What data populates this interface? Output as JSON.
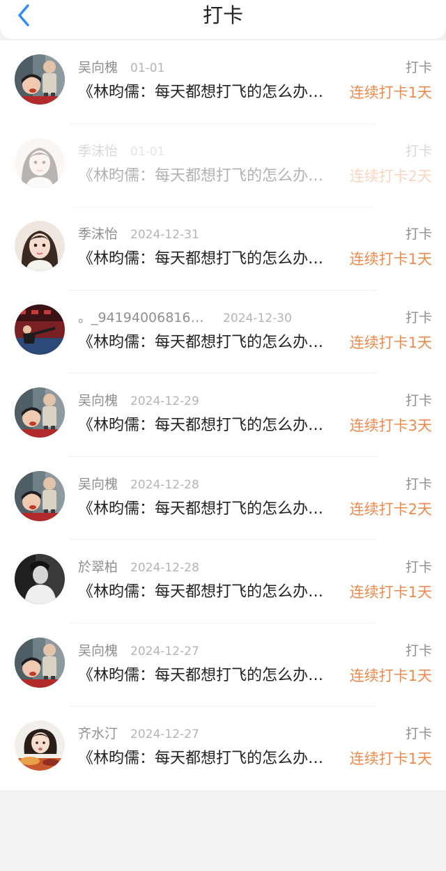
{
  "header": {
    "title": "打卡",
    "back_icon": "chevron-left-icon",
    "back_color": "#2d8cf0"
  },
  "colors": {
    "streak": "#ee8a4c",
    "meta": "#8f8f8f",
    "date": "#b4b4b4"
  },
  "records": [
    {
      "name": "吴向槐",
      "date": "01-01",
      "tag": "打卡",
      "content": "《林昀儒：每天都想打飞的怎么办…",
      "streak": "连续打卡1天",
      "avatar": "avatar-child",
      "faded": false
    },
    {
      "name": "季沫怡",
      "date": "01-01",
      "tag": "打卡",
      "content": "《林昀儒：每天都想打飞的怎么办…",
      "streak": "连续打卡2天",
      "avatar": "avatar-girl",
      "faded": true
    },
    {
      "name": "季沫怡",
      "date": "2024-12-31",
      "tag": "打卡",
      "content": "《林昀儒：每天都想打飞的怎么办…",
      "streak": "连续打卡1天",
      "avatar": "avatar-girl",
      "faded": false
    },
    {
      "name": "。_941940068162…",
      "date": "2024-12-30",
      "tag": "打卡",
      "content": "《林昀儒：每天都想打飞的怎么办…",
      "streak": "连续打卡1天",
      "avatar": "avatar-table-tennis",
      "faded": false
    },
    {
      "name": "吴向槐",
      "date": "2024-12-29",
      "tag": "打卡",
      "content": "《林昀儒：每天都想打飞的怎么办…",
      "streak": "连续打卡3天",
      "avatar": "avatar-child",
      "faded": false
    },
    {
      "name": "吴向槐",
      "date": "2024-12-28",
      "tag": "打卡",
      "content": "《林昀儒：每天都想打飞的怎么办…",
      "streak": "连续打卡2天",
      "avatar": "avatar-child",
      "faded": false
    },
    {
      "name": "於翠柏",
      "date": "2024-12-28",
      "tag": "打卡",
      "content": "《林昀儒：每天都想打飞的怎么办…",
      "streak": "连续打卡1天",
      "avatar": "avatar-bw-man",
      "faded": false
    },
    {
      "name": "吴向槐",
      "date": "2024-12-27",
      "tag": "打卡",
      "content": "《林昀儒：每天都想打飞的怎么办…",
      "streak": "连续打卡1天",
      "avatar": "avatar-child",
      "faded": false
    },
    {
      "name": "齐水汀",
      "date": "2024-12-27",
      "tag": "打卡",
      "content": "《林昀儒：每天都想打飞的怎么办…",
      "streak": "连续打卡1天",
      "avatar": "avatar-girl-dining",
      "faded": false
    }
  ]
}
